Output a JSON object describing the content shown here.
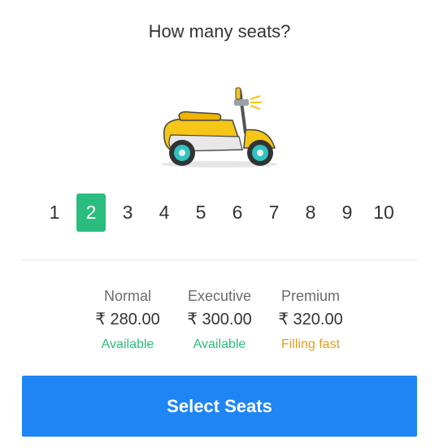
{
  "header": {
    "title": "How many seats?"
  },
  "illustration": {
    "icon": "scooter-icon"
  },
  "seats": {
    "options": [
      "1",
      "2",
      "3",
      "4",
      "5",
      "6",
      "7",
      "8",
      "9",
      "10"
    ],
    "selected": "2"
  },
  "tiers": [
    {
      "name": "Normal",
      "price": "₹ 280.00",
      "status": "Available",
      "status_color": "#2bbd7e"
    },
    {
      "name": "Executive",
      "price": "₹ 300.00",
      "status": "Available",
      "status_color": "#2bbd7e"
    },
    {
      "name": "Premium",
      "price": "₹ 320.00",
      "status": "Filling fast",
      "status_color": "#e69b1e"
    }
  ],
  "footer": {
    "cta_label": "Select Seats"
  },
  "colors": {
    "accent": "#1f85f5",
    "selected": "#2bbd7e",
    "available": "#2bbd7e",
    "filling_fast": "#e69b1e"
  }
}
